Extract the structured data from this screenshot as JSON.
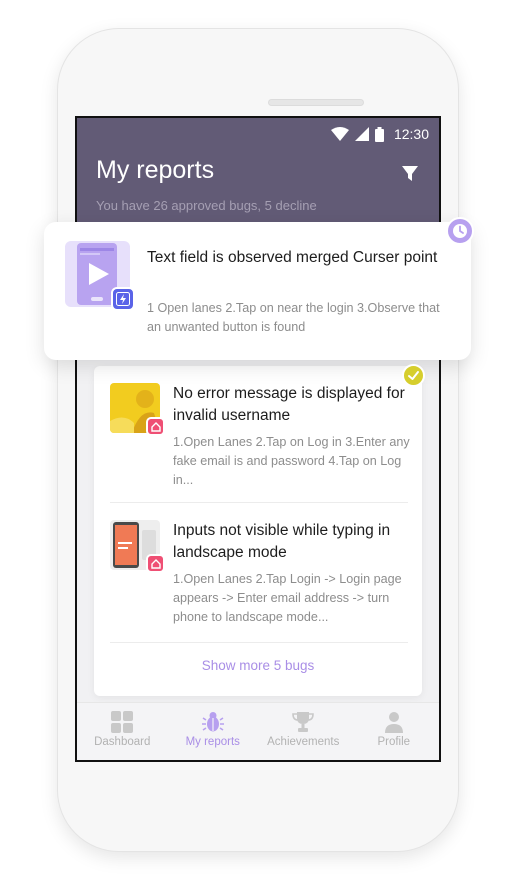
{
  "status_bar": {
    "time": "12:30",
    "icons": [
      "wifi-icon",
      "signal-icon",
      "battery-icon"
    ]
  },
  "header": {
    "title": "My reports",
    "subtitle": "You have 26 approved bugs, 5 decline",
    "filter_icon": "filter-icon"
  },
  "highlight": {
    "title": "Text field is observed merged Curser point",
    "description": "1 Open lanes 2.Tap on near the login 3.Observe that an unwanted button is found",
    "badge_icon": "clock-icon"
  },
  "reports": [
    {
      "title": "No error message is displayed for invalid username",
      "description": "1.Open Lanes 2.Tap on Log in 3.Enter any fake email is and password 4.Tap on Log in..."
    },
    {
      "title": "Inputs not visible while typing in landscape mode",
      "description": "1.Open Lanes 2.Tap Login -> Login page appears -> Enter email address -> turn phone to landscape mode..."
    }
  ],
  "show_more": "Show more 5 bugs",
  "nav": [
    {
      "label": "Dashboard",
      "icon": "dashboard-icon",
      "active": false
    },
    {
      "label": "My reports",
      "icon": "bug-icon",
      "active": true
    },
    {
      "label": "Achievements",
      "icon": "trophy-icon",
      "active": false
    },
    {
      "label": "Profile",
      "icon": "profile-icon",
      "active": false
    }
  ],
  "colors": {
    "header": "#625b76",
    "accent": "#a98ee6",
    "bug_badge": "#ef4f74",
    "approved": "#d6ce2d"
  }
}
